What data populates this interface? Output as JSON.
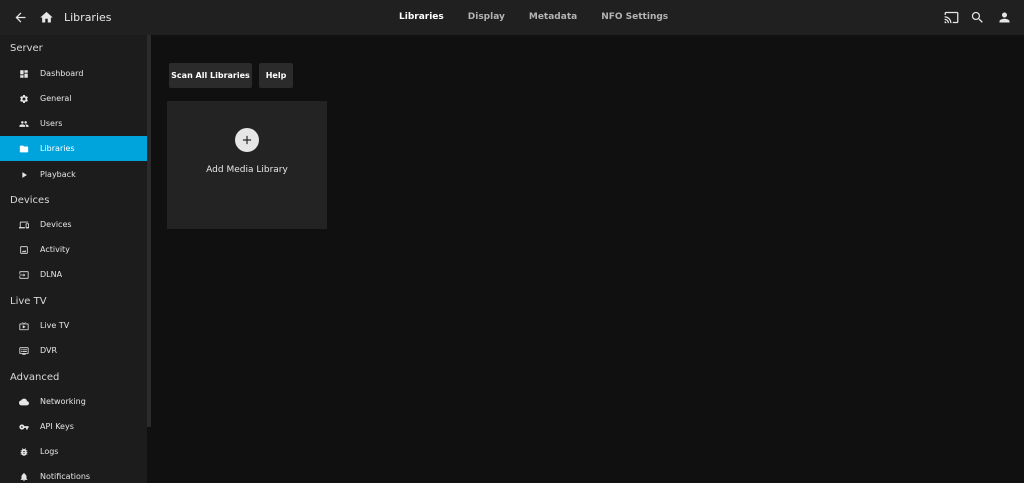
{
  "header": {
    "title": "Libraries",
    "icons": [
      "back-arrow-icon",
      "home-icon",
      "cast-icon",
      "search-icon",
      "user-icon"
    ]
  },
  "tabs": [
    {
      "label": "Libraries",
      "active": true
    },
    {
      "label": "Display",
      "active": false
    },
    {
      "label": "Metadata",
      "active": false
    },
    {
      "label": "NFO Settings",
      "active": false
    }
  ],
  "sidebar": {
    "sections": {
      "server": "Server",
      "devices": "Devices",
      "livetv": "Live TV",
      "advanced": "Advanced"
    },
    "items": {
      "dashboard": "Dashboard",
      "general": "General",
      "users": "Users",
      "libraries": "Libraries",
      "playback": "Playback",
      "devices": "Devices",
      "activity": "Activity",
      "dlna": "DLNA",
      "livetv": "Live TV",
      "dvr": "DVR",
      "networking": "Networking",
      "apikeys": "API Keys",
      "logs": "Logs",
      "notifications": "Notifications"
    },
    "active_item": "Libraries"
  },
  "main": {
    "scan_all_label": "Scan All Libraries",
    "help_label": "Help",
    "add_library_label": "Add Media Library"
  },
  "colors": {
    "accent": "#00a4dc",
    "header_bg": "#202020",
    "sidebar_bg": "#1c1c1c",
    "page_bg": "#101010",
    "card_bg": "#232323",
    "button_bg": "#2b2b2b"
  }
}
